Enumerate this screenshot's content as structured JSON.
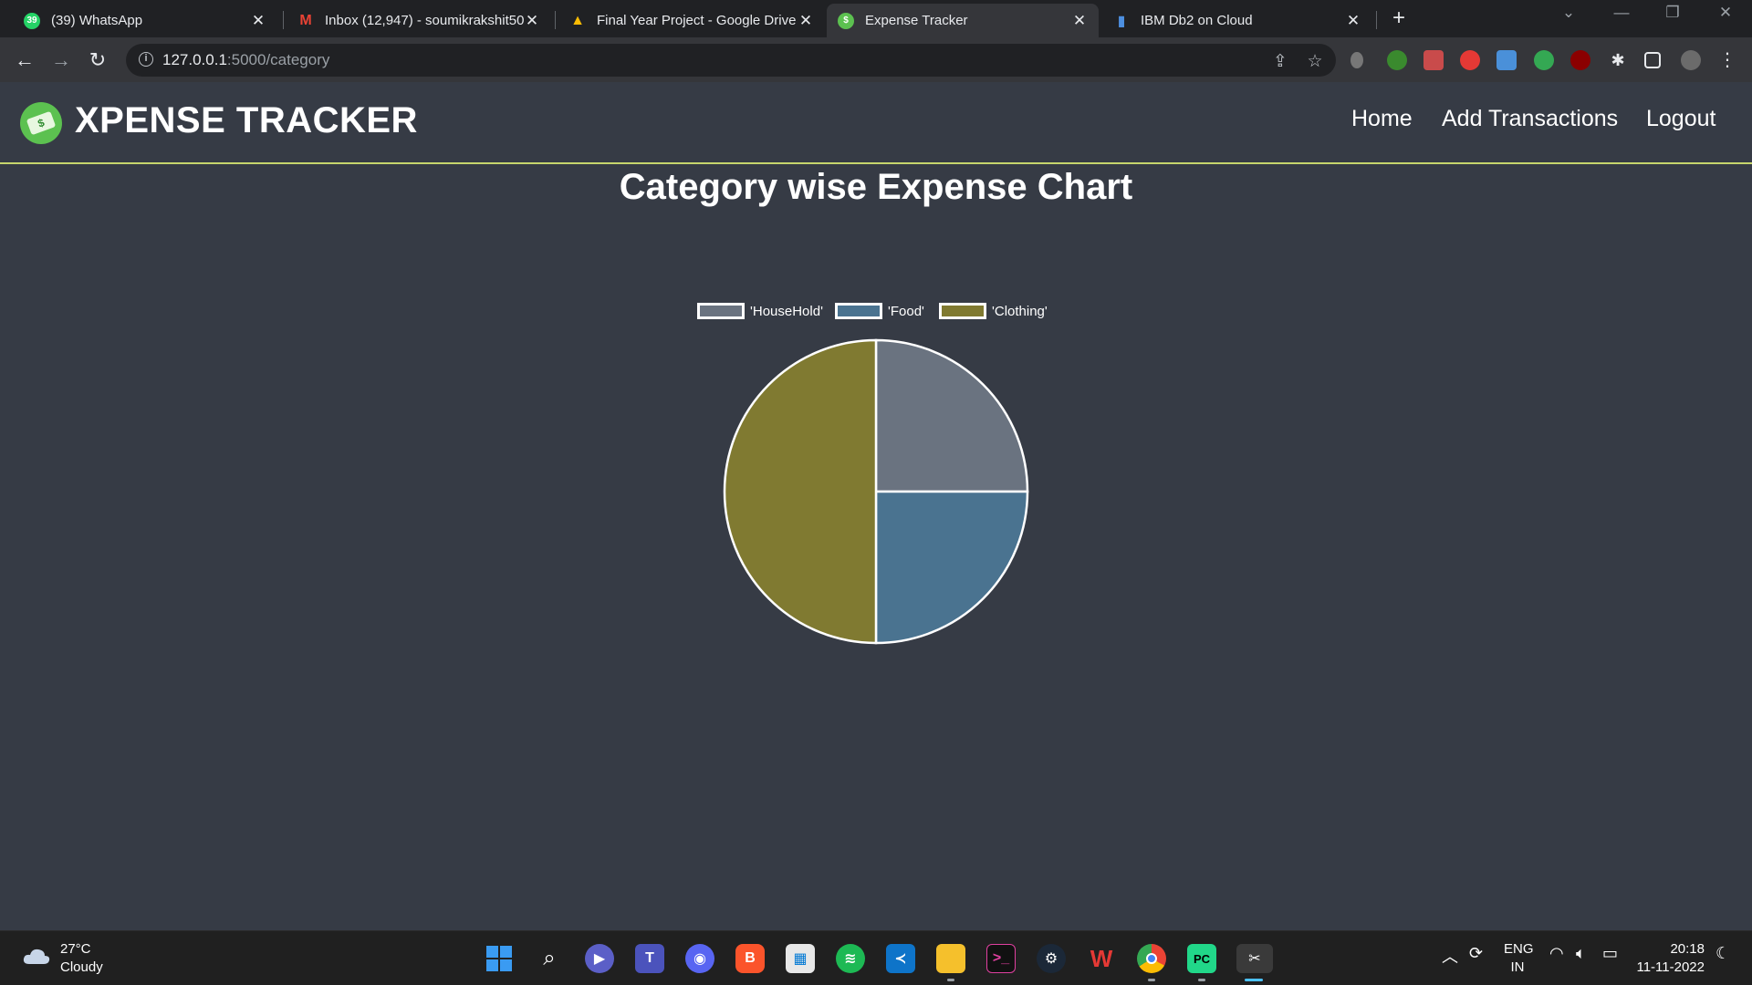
{
  "browser": {
    "tabs": [
      {
        "title": "(39) WhatsApp",
        "favicon": "whatsapp-icon",
        "color": "#25d366",
        "glyph": "39"
      },
      {
        "title": "Inbox (12,947) - soumikrakshit50",
        "favicon": "gmail-icon",
        "color": "#ea4335",
        "glyph": "M"
      },
      {
        "title": "Final Year Project - Google Drive",
        "favicon": "google-drive-icon",
        "color": "#1fa463",
        "glyph": "▲"
      },
      {
        "title": "Expense Tracker",
        "favicon": "expense-tracker-icon",
        "color": "#5cc150",
        "glyph": "$"
      },
      {
        "title": "IBM Db2 on Cloud",
        "favicon": "ibm-db2-icon",
        "color": "#1f70c1",
        "glyph": "▮"
      }
    ],
    "url_host": "127.0.0.1",
    "url_rest": ":5000/category"
  },
  "app": {
    "brand": "XPENSE TRACKER",
    "nav": {
      "home": "Home",
      "add": "Add Transactions",
      "logout": "Logout"
    },
    "page_title": "Category wise Expense Chart"
  },
  "chart_data": {
    "type": "pie",
    "labels": [
      "'HouseHold'",
      "'Food'",
      "'Clothing'"
    ],
    "values": [
      25,
      25,
      50
    ],
    "colors": [
      "#6a7380",
      "#4a7390",
      "#807a31"
    ],
    "legend": "top"
  },
  "taskbar": {
    "temp": "27°C",
    "weather": "Cloudy",
    "lang1": "ENG",
    "lang2": "IN",
    "time": "20:18",
    "date": "11-11-2022"
  }
}
